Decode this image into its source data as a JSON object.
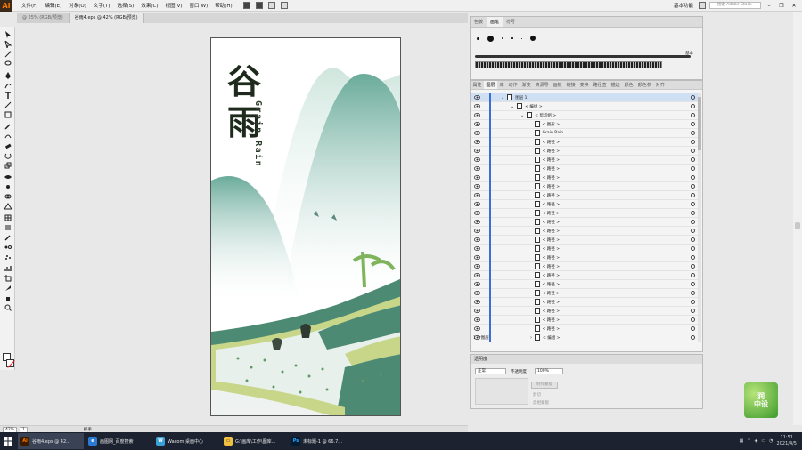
{
  "app": {
    "logo": "Ai"
  },
  "menu": [
    "文件(F)",
    "编辑(E)",
    "对象(O)",
    "文字(T)",
    "选择(S)",
    "效果(C)",
    "视图(V)",
    "窗口(W)",
    "帮助(H)"
  ],
  "workspace": "基本功能",
  "stock_search": {
    "placeholder": "搜索 Adobe Stock"
  },
  "doc_tabs": [
    {
      "label": "@ 25% (RGB/预览)",
      "active": false
    },
    {
      "label": "谷雨4.eps @ 42% (RGB/预览)",
      "active": true
    }
  ],
  "artboard": {
    "title_cn": "谷雨",
    "title_en": "Grain Rain"
  },
  "status": {
    "zoom": "42%",
    "artboard_num": "1",
    "tool": "抓手"
  },
  "brush_panel": {
    "tabs": [
      {
        "label": "色板",
        "active": false
      },
      {
        "label": "画笔",
        "active": true
      },
      {
        "label": "符号",
        "active": false
      }
    ],
    "base_label": "基本"
  },
  "layers_panel": {
    "tabs": [
      {
        "label": "属性",
        "active": false
      },
      {
        "label": "图层",
        "active": true
      },
      {
        "label": "库",
        "active": false
      },
      {
        "label": "动作",
        "active": false
      },
      {
        "label": "渐变",
        "active": false
      },
      {
        "label": "资源导",
        "active": false
      },
      {
        "label": "画板",
        "active": false
      },
      {
        "label": "链接",
        "active": false
      },
      {
        "label": "变换",
        "active": false
      },
      {
        "label": "路径查",
        "active": false
      },
      {
        "label": "描边",
        "active": false
      },
      {
        "label": "颜色",
        "active": false
      },
      {
        "label": "颜色参",
        "active": false
      },
      {
        "label": "对齐",
        "active": false
      }
    ],
    "rows": [
      {
        "label": "图层 1",
        "indent": 0,
        "toggle": "v",
        "selected": true
      },
      {
        "label": "< 编组 >",
        "indent": 1,
        "toggle": "v",
        "selected": false
      },
      {
        "label": "< 剪切组 >",
        "indent": 2,
        "toggle": "v",
        "selected": false
      },
      {
        "label": "< 图形 >",
        "indent": 3,
        "toggle": "",
        "selected": false
      },
      {
        "label": "Grain Rain",
        "indent": 3,
        "toggle": "",
        "selected": false
      },
      {
        "label": "< 路径 >",
        "indent": 3,
        "toggle": "",
        "selected": false
      },
      {
        "label": "< 路径 >",
        "indent": 3,
        "toggle": "",
        "selected": false
      },
      {
        "label": "< 路径 >",
        "indent": 3,
        "toggle": "",
        "selected": false
      },
      {
        "label": "< 路径 >",
        "indent": 3,
        "toggle": "",
        "selected": false
      },
      {
        "label": "< 路径 >",
        "indent": 3,
        "toggle": "",
        "selected": false
      },
      {
        "label": "< 路径 >",
        "indent": 3,
        "toggle": "",
        "selected": false
      },
      {
        "label": "< 路径 >",
        "indent": 3,
        "toggle": "",
        "selected": false
      },
      {
        "label": "< 路径 >",
        "indent": 3,
        "toggle": "",
        "selected": false
      },
      {
        "label": "< 路径 >",
        "indent": 3,
        "toggle": "",
        "selected": false
      },
      {
        "label": "< 路径 >",
        "indent": 3,
        "toggle": "",
        "selected": false
      },
      {
        "label": "< 路径 >",
        "indent": 3,
        "toggle": "",
        "selected": false
      },
      {
        "label": "< 路径 >",
        "indent": 3,
        "toggle": "",
        "selected": false
      },
      {
        "label": "< 路径 >",
        "indent": 3,
        "toggle": "",
        "selected": false
      },
      {
        "label": "< 路径 >",
        "indent": 3,
        "toggle": "",
        "selected": false
      },
      {
        "label": "< 路径 >",
        "indent": 3,
        "toggle": "",
        "selected": false
      },
      {
        "label": "< 路径 >",
        "indent": 3,
        "toggle": "",
        "selected": false
      },
      {
        "label": "< 路径 >",
        "indent": 3,
        "toggle": "",
        "selected": false
      },
      {
        "label": "< 路径 >",
        "indent": 3,
        "toggle": "",
        "selected": false
      },
      {
        "label": "< 路径 >",
        "indent": 3,
        "toggle": "",
        "selected": false
      },
      {
        "label": "< 路径 >",
        "indent": 3,
        "toggle": "",
        "selected": false
      },
      {
        "label": "< 路径 >",
        "indent": 3,
        "toggle": "",
        "selected": false
      },
      {
        "label": "< 路径 >",
        "indent": 3,
        "toggle": "",
        "selected": false
      },
      {
        "label": "< 编组 >",
        "indent": 3,
        "toggle": ">",
        "selected": false
      }
    ],
    "footer": "1 个图层"
  },
  "transparency_panel": {
    "title": "透明度",
    "mode": "正常",
    "opacity_label": "不透明度",
    "opacity": "100%",
    "mask_btn": "制作蒙版",
    "clip": "剪切",
    "invert": "反相蒙版"
  },
  "badge": {
    "text": "润\n中设"
  },
  "taskbar": [
    {
      "label": "谷雨4.eps @ 42...",
      "icon": "Ai",
      "color": "#ff7c00",
      "bg": "#3b1a00",
      "active": true
    },
    {
      "label": "画图网_百度搜索",
      "icon": "e",
      "color": "#fff",
      "bg": "#2b7bd4",
      "active": false
    },
    {
      "label": "Wacom 桌面中心",
      "icon": "W",
      "color": "#fff",
      "bg": "#3aa0d8",
      "active": false
    },
    {
      "label": "G:\\画库\\工作\\图库...",
      "icon": "▭",
      "color": "#333",
      "bg": "#f0c040",
      "active": false
    },
    {
      "label": "未标题-1 @ 66.7...",
      "icon": "Ps",
      "color": "#31a8ff",
      "bg": "#001d34",
      "active": false
    }
  ],
  "clock": {
    "time": "11:51",
    "date": "2021/4/5"
  },
  "colors": {
    "ai_orange": "#ff7c00",
    "select_blue": "#cfdff4",
    "layer_blue": "#3a6fd6",
    "teal": "#5b9e8c"
  }
}
